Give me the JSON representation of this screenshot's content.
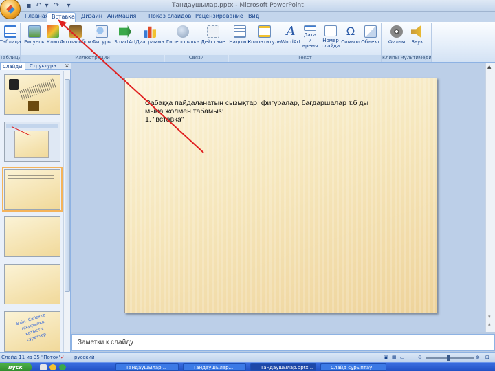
{
  "title_bar": {
    "doc_title": "Тандаушылар.pptx - Microsoft PowerPoint"
  },
  "tabs": [
    "Главная",
    "Вставка",
    "Дизайн",
    "Анимация",
    "Показ слайдов",
    "Рецензирование",
    "Вид"
  ],
  "active_tab": "Вставка",
  "ribbon": {
    "groups": [
      {
        "label": "Таблицы",
        "buttons": [
          "Таблица"
        ]
      },
      {
        "label": "Иллюстрации",
        "buttons": [
          "Рисунок",
          "Клип",
          "Фотоальбом",
          "Фигуры",
          "SmartArt",
          "Диаграмма"
        ]
      },
      {
        "label": "Связи",
        "buttons": [
          "Гиперссылка",
          "Действие"
        ]
      },
      {
        "label": "Текст",
        "buttons": [
          "Надпись",
          "Колонтитулы",
          "WordArt",
          "Дата и время",
          "Номер слайда",
          "Символ",
          "Объект"
        ]
      },
      {
        "label": "Клипы мультимедиа",
        "buttons": [
          "Фильм",
          "Звук"
        ]
      }
    ]
  },
  "panel": {
    "tabs": [
      "Слайды",
      "Структура"
    ],
    "close": "×",
    "thumb6_text": "Өлім. Сабақта тақырыпқа қатысты суреттер"
  },
  "slide": {
    "lines": [
      "Сабаққа  пайдаланатын  сызықтар, фигуралар, бағдаршалар т.б  ды",
      "мына жолмен табамыз:",
      "1. \"вставка\""
    ]
  },
  "notes": {
    "placeholder": "Заметки к слайду"
  },
  "status": {
    "slide_counter": "Слайд 11 из 35",
    "theme": "\"Поток\"",
    "language": "русский"
  },
  "taskbar": {
    "start": "пуск",
    "items": [
      "Тандаушылар...",
      "Тандаушылар...",
      "Тандаушылар.pptx...",
      "Слайд сұрыптау"
    ]
  }
}
